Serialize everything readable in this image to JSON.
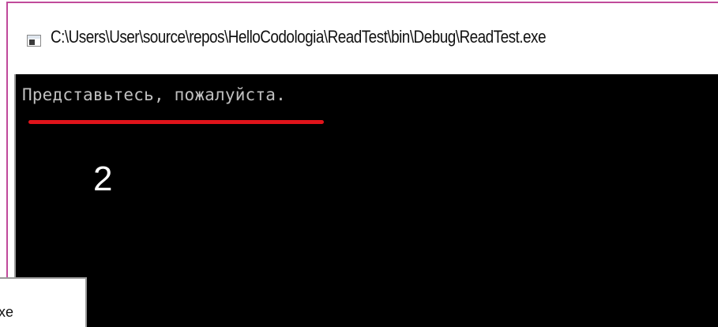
{
  "window": {
    "title": "C:\\Users\\User\\source\\repos\\HelloCodologia\\ReadTest\\bin\\Debug\\ReadTest.exe",
    "app_icon": "console-app-icon",
    "border_color": "#c04a9b"
  },
  "console": {
    "background": "#000000",
    "text_color": "#c0c0c0",
    "lines": [
      "Представьтесь, пожалуйста."
    ]
  },
  "annotation": {
    "step_number": "2",
    "underline_color": "#e0141b"
  },
  "background_window": {
    "partial_title": "xe"
  }
}
